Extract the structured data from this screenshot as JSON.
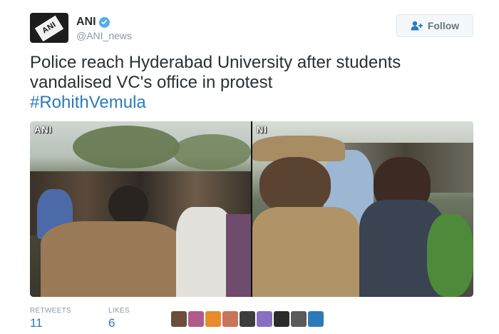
{
  "author": {
    "name": "ANI",
    "handle": "@ANI_news",
    "logo_text": "ANI",
    "verified": true
  },
  "follow_button": {
    "label": "Follow",
    "icon": "add-user-icon"
  },
  "tweet": {
    "text": "Police reach Hyderabad University after students vandalised VC's office in protest",
    "hashtag": "#RohithVemula"
  },
  "media": {
    "left_watermark": "ANI",
    "right_watermark": "NI"
  },
  "stats": {
    "retweets_label": "RETWEETS",
    "retweets": "11",
    "likes_label": "LIKES",
    "likes": "6"
  },
  "likers": [
    {
      "color": "#6b4f3a"
    },
    {
      "color": "#b05a8a"
    },
    {
      "color": "#e98a2c"
    },
    {
      "color": "#c9735a"
    },
    {
      "color": "#3d3d3d"
    },
    {
      "color": "#8a6ec2"
    },
    {
      "color": "#2b2b2b"
    },
    {
      "color": "#5a5a5a"
    },
    {
      "color": "#2b7bb9"
    }
  ],
  "colors": {
    "link": "#2b7bb9",
    "verified": "#55acee",
    "muted": "#8899a6"
  }
}
